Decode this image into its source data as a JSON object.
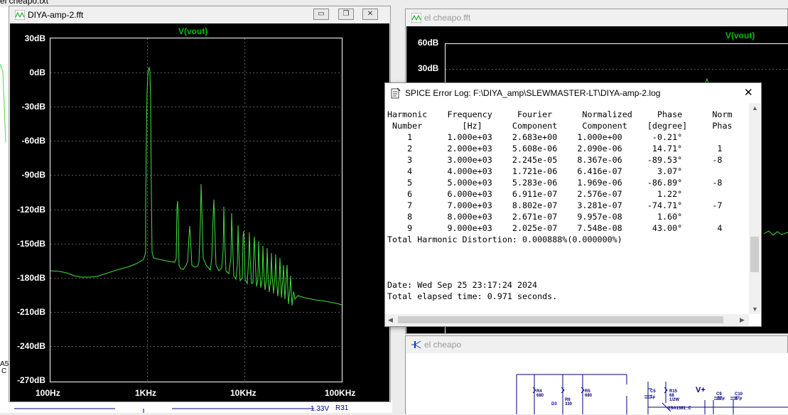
{
  "top_fragment": "el cheapo.txt",
  "fft_window": {
    "title": "DIYA-amp-2.fft",
    "trace_label": "V(vout)",
    "y_ticks": [
      "30dB",
      "0dB",
      "-30dB",
      "-60dB",
      "-90dB",
      "-120dB",
      "-150dB",
      "-180dB",
      "-210dB",
      "-240dB",
      "-270dB"
    ],
    "x_ticks": [
      "100Hz",
      "1KHz",
      "10KHz",
      "100KHz"
    ],
    "trace_color": "#40e040",
    "btn_minimize": "▭",
    "btn_restore": "❐",
    "btn_close": "✕"
  },
  "cheapo_fft_window": {
    "title": "el cheapo.fft",
    "trace_label": "V(vout)",
    "y_ticks": [
      "60dB",
      "30dB"
    ]
  },
  "schematic_window": {
    "title": "el cheapo",
    "labels": [
      "R4",
      "680",
      "D3",
      "R6",
      "330",
      "R5",
      "680",
      "C5",
      "1µ",
      "R15",
      "68",
      "1/2W",
      "2SA1381_C",
      "V+",
      "C9",
      ".02µ",
      "C10",
      "47µ",
      "R31",
      "1.33V"
    ]
  },
  "spice_log": {
    "title": "SPICE Error Log: F:\\DIYA_amp\\SLEWMASTER-LT\\DIYA-amp-2.log",
    "close": "✕",
    "header_line1": "Harmonic    Frequency     Fourier      Normalized     Phase      Norm",
    "header_line2": " Number        [Hz]      Component     Component    [degree]     Phas",
    "rows": [
      "    1       1.000e+03    2.683e+00    1.000e+00      -0.21°",
      "    2       2.000e+03    5.608e-06    2.090e-06      14.71°       1",
      "    3       3.000e+03    2.245e-05    8.367e-06     -89.53°      -8",
      "    4       4.000e+03    1.721e-06    6.416e-07       3.07°",
      "    5       5.000e+03    5.283e-06    1.969e-06     -86.89°      -8",
      "    6       6.000e+03    6.911e-07    2.576e-07       1.22°",
      "    7       7.000e+03    8.802e-07    3.281e-07     -74.71°      -7",
      "    8       8.000e+03    2.671e-07    9.957e-08       1.60°",
      "    9       9.000e+03    2.025e-07    7.548e-08      43.00°       4"
    ],
    "thd_line": "Total Harmonic Distortion: 0.000888%(0.000000%)",
    "date_line": "Date: Wed Sep 25 23:17:24 2024",
    "elapsed_line": "Total elapsed time: 0.971 seconds."
  },
  "left_edge_fragments": [
    "A5",
    "C"
  ]
}
